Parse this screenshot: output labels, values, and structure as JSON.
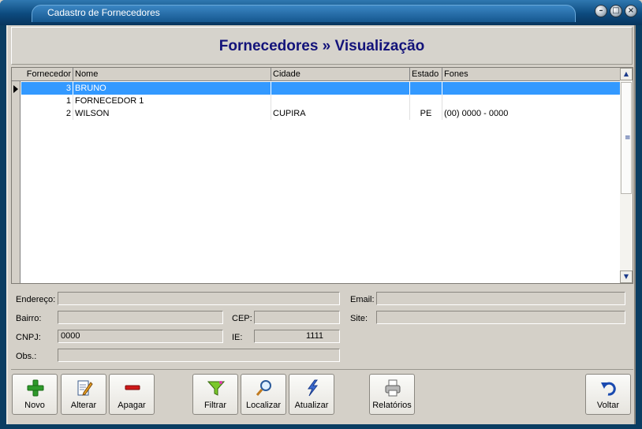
{
  "window": {
    "title": "Cadastro de Fornecedores",
    "controls": [
      "minimize",
      "maximize",
      "close"
    ]
  },
  "header": {
    "title": "Fornecedores » Visualização"
  },
  "grid": {
    "columns": [
      "Fornecedor",
      "Nome",
      "Cidade",
      "Estado",
      "Fones"
    ],
    "rows": [
      {
        "id": "3",
        "nome": "BRUNO",
        "cidade": "",
        "estado": "",
        "fones": ""
      },
      {
        "id": "1",
        "nome": "FORNECEDOR 1",
        "cidade": "",
        "estado": "",
        "fones": ""
      },
      {
        "id": "2",
        "nome": "WILSON",
        "cidade": "CUPIRA",
        "estado": "PE",
        "fones": "(00) 0000 - 0000"
      }
    ],
    "selected_row": 0
  },
  "details": {
    "endereco_label": "Endereço:",
    "endereco_value": "",
    "email_label": "Email:",
    "email_value": "",
    "bairro_label": "Bairro:",
    "bairro_value": "",
    "cep_label": "CEP:",
    "cep_value": "",
    "site_label": "Site:",
    "site_value": "",
    "cnpj_label": "CNPJ:",
    "cnpj_value": "0000",
    "ie_label": "IE:",
    "ie_value": "1111",
    "obs_label": "Obs.:",
    "obs_value": ""
  },
  "toolbar": {
    "novo": "Novo",
    "alterar": "Alterar",
    "apagar": "Apagar",
    "filtrar": "Filtrar",
    "localizar": "Localizar",
    "atualizar": "Atualizar",
    "relatorios": "Relatórios",
    "voltar": "Voltar"
  },
  "colors": {
    "title_blue": "#13137a",
    "selection": "#3399ff",
    "titlebar": "#0c4a7e"
  }
}
